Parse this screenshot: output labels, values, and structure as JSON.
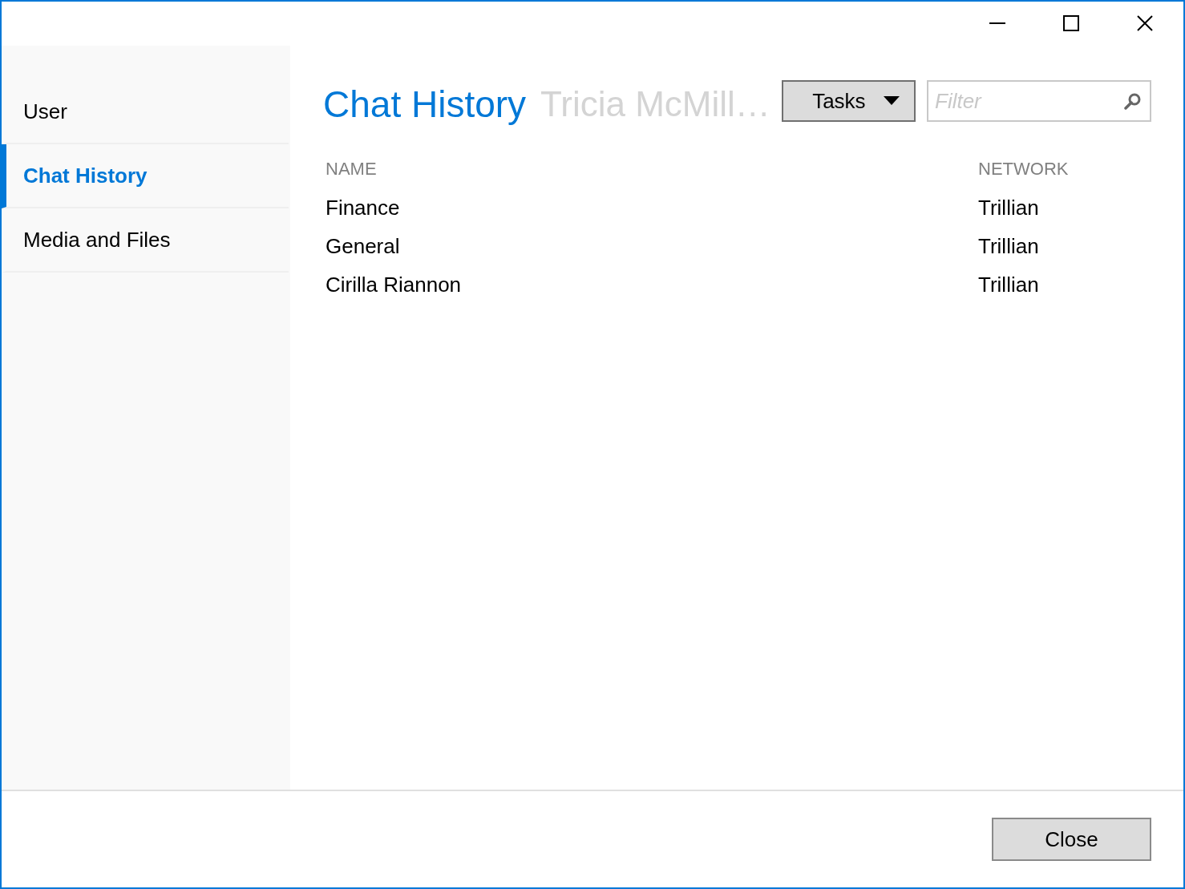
{
  "sidebar": {
    "items": [
      {
        "label": "User",
        "selected": false
      },
      {
        "label": "Chat History",
        "selected": true
      },
      {
        "label": "Media and Files",
        "selected": false
      }
    ]
  },
  "header": {
    "title": "Chat History",
    "subtitle": "Tricia McMill…"
  },
  "tasks_button": {
    "label": "Tasks"
  },
  "filter": {
    "placeholder": "Filter"
  },
  "table": {
    "columns": [
      "NAME",
      "NETWORK"
    ],
    "rows": [
      [
        "Finance",
        "Trillian"
      ],
      [
        "General",
        "Trillian"
      ],
      [
        "Cirilla Riannon",
        "Trillian"
      ]
    ]
  },
  "footer": {
    "buttons": [
      "Close"
    ]
  }
}
